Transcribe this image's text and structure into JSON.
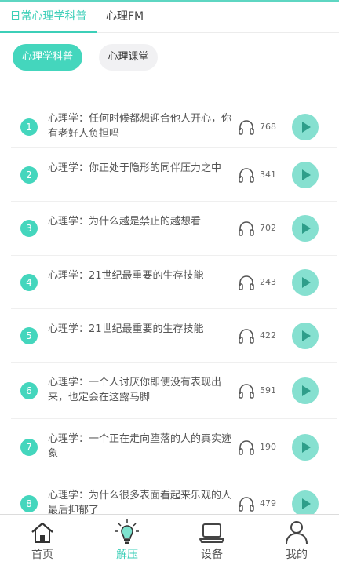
{
  "top_tabs": [
    {
      "label": "日常心理学科普",
      "active": true
    },
    {
      "label": "心理FM",
      "active": false
    }
  ],
  "chips": [
    {
      "label": "心理学科普",
      "active": true
    },
    {
      "label": "心理课堂",
      "active": false
    }
  ],
  "items": [
    {
      "num": "1",
      "title": "心理学：任何时候都想迎合他人开心，你有老好人负担吗",
      "count": "768"
    },
    {
      "num": "2",
      "title": "心理学：你正处于隐形的同伴压力之中",
      "count": "341"
    },
    {
      "num": "3",
      "title": "心理学：为什么越是禁止的越想看",
      "count": "702"
    },
    {
      "num": "4",
      "title": "心理学：21世纪最重要的生存技能",
      "count": "243"
    },
    {
      "num": "5",
      "title": "心理学：21世纪最重要的生存技能",
      "count": "422"
    },
    {
      "num": "6",
      "title": "心理学：一个人讨厌你即使没有表现出来，也定会在这露马脚",
      "count": "591"
    },
    {
      "num": "7",
      "title": "心理学：一个正在走向堕落的人的真实迹象",
      "count": "190"
    },
    {
      "num": "8",
      "title": "心理学：为什么很多表面看起来乐观的人最后抑郁了",
      "count": "479"
    }
  ],
  "bottom_nav": [
    {
      "label": "首页",
      "icon": "home-icon",
      "active": false
    },
    {
      "label": "解压",
      "icon": "lightbulb-icon",
      "active": true
    },
    {
      "label": "设备",
      "icon": "laptop-icon",
      "active": false
    },
    {
      "label": "我的",
      "icon": "person-icon",
      "active": false
    }
  ],
  "colors": {
    "accent": "#44d6bd",
    "play_bg": "#86e0d0",
    "play_icon": "#2e9e8a"
  }
}
